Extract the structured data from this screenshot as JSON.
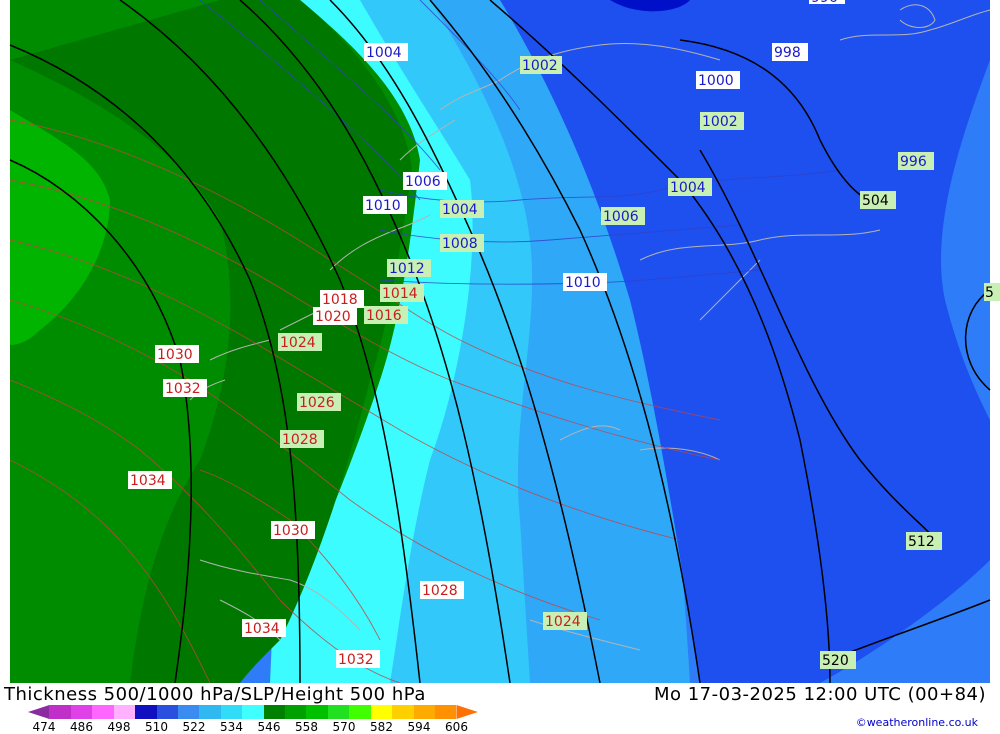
{
  "footer": {
    "title": "Thickness 500/1000 hPa/SLP/Height 500 hPa",
    "datetime": "Mo 17-03-2025 12:00 UTC (00+84)",
    "credit": "©weatheronline.co.uk"
  },
  "legend": {
    "ticks": [
      "474",
      "486",
      "498",
      "510",
      "522",
      "534",
      "546",
      "558",
      "570",
      "582",
      "594",
      "606"
    ],
    "colors": [
      "#8c2aa0",
      "#c030c8",
      "#e040e8",
      "#ff66ff",
      "#ffb0ff",
      "#1010c0",
      "#2a50e0",
      "#3a8cf0",
      "#30b8f0",
      "#30dcf8",
      "#40ffff",
      "#008000",
      "#00a000",
      "#00c000",
      "#20e020",
      "#40ff00",
      "#ffff00",
      "#ffd000",
      "#ffaa00",
      "#ff9000",
      "#ff7000"
    ]
  },
  "map": {
    "colors": {
      "deep_blue": "#0010c8",
      "blue": "#1e50f0",
      "mid_blue": "#2e7cf8",
      "light_blue": "#30a8f8",
      "sky": "#32c8fa",
      "cyan": "#3cfcff",
      "green_dark": "#007800",
      "green": "#008c00",
      "green_light": "#00b400",
      "coast": "#b4b4b4"
    },
    "slp_labels_blue": [
      "1004",
      "1002",
      "998",
      "1000",
      "1006",
      "1010",
      "1010"
    ],
    "slp_labels_red": [
      "1018",
      "1020",
      "1014",
      "1016",
      "1030",
      "1032",
      "1034",
      "1030",
      "1028",
      "1034",
      "1032"
    ],
    "slp_labels_green": [
      "1002",
      "1004",
      "1004",
      "1008",
      "1012",
      "1006",
      "1024",
      "1026",
      "1028",
      "1024",
      "996"
    ],
    "height_labels": [
      "504",
      "512",
      "520"
    ],
    "partial_labels": [
      "996",
      "5"
    ]
  }
}
